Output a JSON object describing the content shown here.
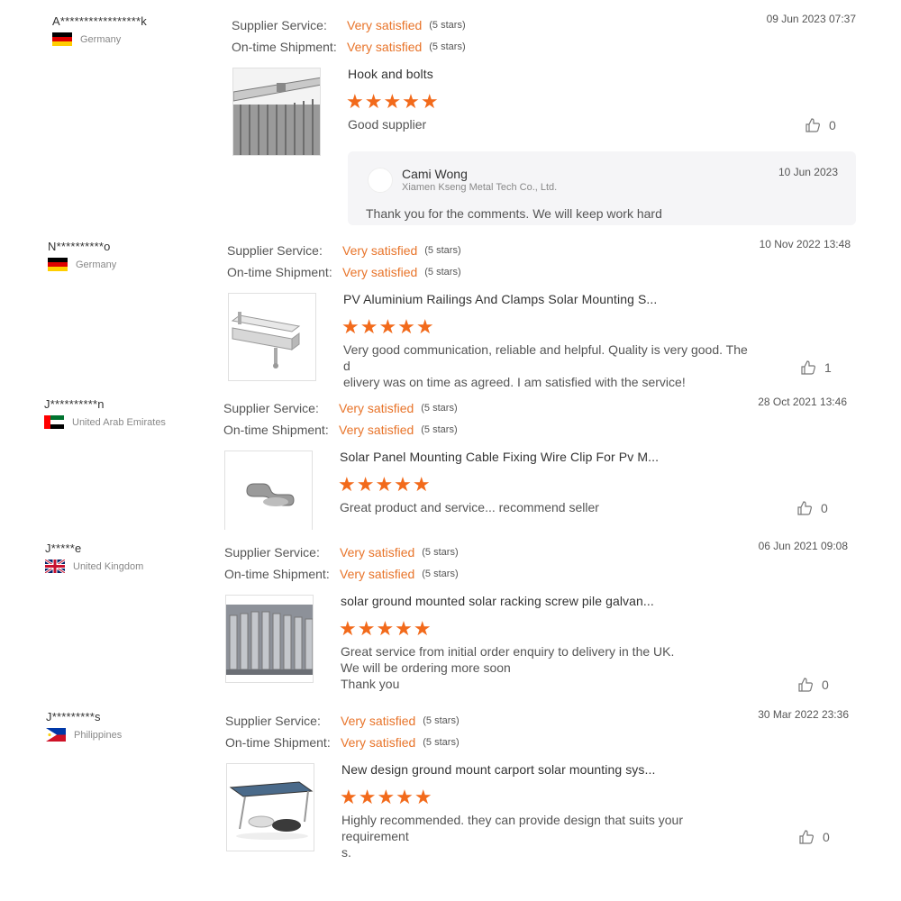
{
  "labels": {
    "supplier_service": "Supplier Service:",
    "ontime_shipment": "On-time Shipment:"
  },
  "colors": {
    "accent": "#e8742a",
    "star": "#f26a1b"
  },
  "reviews": [
    {
      "buyer": "A*****************k",
      "country": "Germany",
      "flag": "germany-flag",
      "supplier_service": {
        "value": "Very satisfied",
        "stars": "(5 stars)"
      },
      "ontime_shipment": {
        "value": "Very satisfied",
        "stars": "(5 stars)"
      },
      "date": "09 Jun 2023 07:37",
      "product_title": "Hook and bolts",
      "rating": "★★★★★",
      "comment": "Good supplier",
      "likes": "0",
      "reply": {
        "name": "Cami Wong",
        "company": "Xiamen Kseng Metal Tech Co., Ltd.",
        "date": "10 Jun 2023",
        "text": "Thank you for the comments. We will keep work hard"
      }
    },
    {
      "buyer": "N**********o",
      "country": "Germany",
      "flag": "germany-flag",
      "supplier_service": {
        "value": "Very satisfied",
        "stars": "(5 stars)"
      },
      "ontime_shipment": {
        "value": "Very satisfied",
        "stars": "(5 stars)"
      },
      "date": "10 Nov 2022 13:48",
      "product_title": "PV Aluminium Railings And Clamps Solar Mounting S...",
      "rating": "★★★★★",
      "comment": "Very good communication, reliable and helpful. Quality is very good. The d\nelivery was on time as agreed. I am satisfied with the service!",
      "likes": "1"
    },
    {
      "buyer": "J**********n",
      "country": "United Arab Emirates",
      "flag": "uae-flag",
      "supplier_service": {
        "value": "Very satisfied",
        "stars": "(5 stars)"
      },
      "ontime_shipment": {
        "value": "Very satisfied",
        "stars": "(5 stars)"
      },
      "date": "28 Oct 2021 13:46",
      "product_title": "Solar Panel Mounting Cable Fixing Wire Clip For Pv M...",
      "rating": "★★★★★",
      "comment": "Great product and service... recommend seller",
      "likes": "0"
    },
    {
      "buyer": "J*****e",
      "country": "United Kingdom",
      "flag": "uk-flag",
      "supplier_service": {
        "value": "Very satisfied",
        "stars": "(5 stars)"
      },
      "ontime_shipment": {
        "value": "Very satisfied",
        "stars": "(5 stars)"
      },
      "date": "06 Jun 2021 09:08",
      "product_title": "solar ground mounted solar racking screw pile galvan...",
      "rating": "★★★★★",
      "comment": "Great service from initial order enquiry to delivery in the UK.\nWe will be ordering more soon\nThank you",
      "likes": "0"
    },
    {
      "buyer": "J*********s",
      "country": "Philippines",
      "flag": "philippines-flag",
      "supplier_service": {
        "value": "Very satisfied",
        "stars": "(5 stars)"
      },
      "ontime_shipment": {
        "value": "Very satisfied",
        "stars": "(5 stars)"
      },
      "date": "30 Mar 2022 23:36",
      "product_title": "New design ground mount carport solar mounting sys...",
      "rating": "★★★★★",
      "comment": "Highly recommended. they can provide design that suits your requirement\ns.",
      "likes": "0"
    }
  ]
}
